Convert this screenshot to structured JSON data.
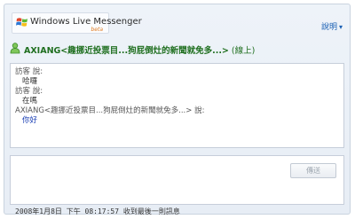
{
  "header": {
    "logo_text": "Windows Live Messenger",
    "logo_badge": "beta",
    "help_label": "說明",
    "help_icon": "chevron-down-icon"
  },
  "conversation": {
    "contact_name": "AXIANG<趣挪近投票目...狗屁倒灶的新聞就免多...>",
    "contact_status": "(線上)",
    "status_icon": "buddy-online-icon"
  },
  "messages": [
    {
      "sender": "訪客 說:",
      "text": "哈囉"
    },
    {
      "sender": "訪客 說:",
      "text": "在嗎"
    },
    {
      "sender": "AXIANG<趣挪近投票目...狗屁倒灶的新聞就免多...> 說:",
      "text": "你好"
    }
  ],
  "compose": {
    "send_label": "傳送"
  },
  "footer": {
    "last_message": "2008年1月8日 下午 08:17:57 收到最後一則訊息"
  },
  "colors": {
    "accent_blue": "#1a5fb4",
    "online_green": "#1f6f1f",
    "frame_bg": "#e7edf5"
  }
}
